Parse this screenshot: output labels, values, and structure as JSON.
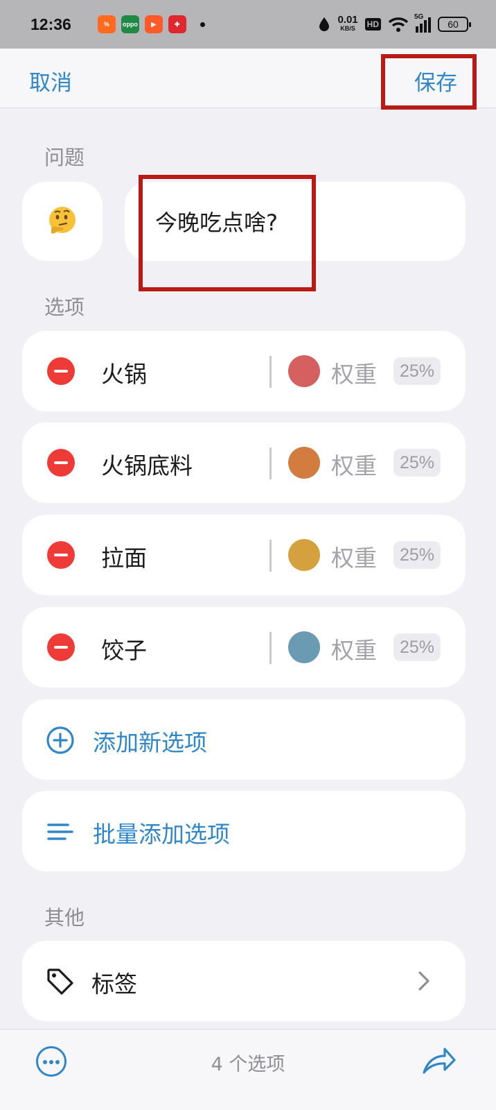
{
  "status_bar": {
    "time": "12:36",
    "net_speed_value": "0.01",
    "net_speed_unit": "KB/S",
    "hd": "HD",
    "signal": "5G",
    "battery": "60",
    "app_icons": [
      "taobao-app-icon",
      "oppo-app-icon",
      "video-app-icon",
      "pinduoduo-app-icon"
    ]
  },
  "nav": {
    "cancel_label": "取消",
    "save_label": "保存"
  },
  "question": {
    "section_label": "问题",
    "emoji": "🤔",
    "text": "今晚吃点啥?"
  },
  "options": {
    "section_label": "选项",
    "items": [
      {
        "label": "火锅",
        "color": "#d4605f",
        "weight_label": "权重",
        "weight": "25%"
      },
      {
        "label": "火锅底料",
        "color": "#d27c40",
        "weight_label": "权重",
        "weight": "25%"
      },
      {
        "label": "拉面",
        "color": "#d5a13f",
        "weight_label": "权重",
        "weight": "25%"
      },
      {
        "label": "饺子",
        "color": "#6a9bb2",
        "weight_label": "权重",
        "weight": "25%"
      }
    ],
    "add_label": "添加新选项",
    "batch_add_label": "批量添加选项"
  },
  "other": {
    "section_label": "其他",
    "tag_label": "标签"
  },
  "bottom": {
    "count_text": "4 个选项"
  },
  "colors": {
    "accent": "#2f87c9",
    "delete": "#ef3b38",
    "highlight_box": "#b81b16"
  }
}
